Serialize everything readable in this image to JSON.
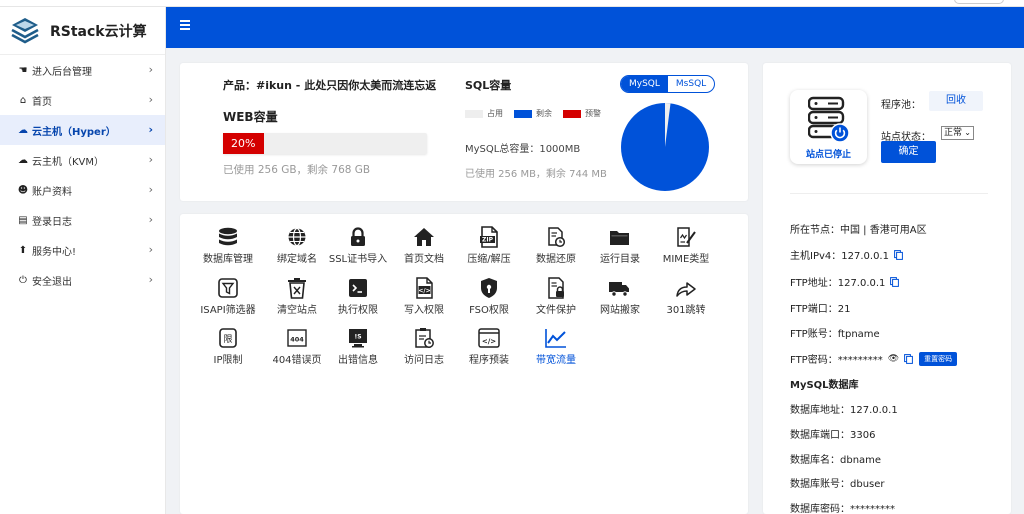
{
  "brand": {
    "name": "RStack云计算"
  },
  "sidebar": {
    "items": [
      {
        "label": "进入后台管理",
        "icon": "hand-pointer-icon",
        "glyph": "☚",
        "active": false
      },
      {
        "label": "首页",
        "icon": "home-icon",
        "glyph": "⌂",
        "active": false
      },
      {
        "label": "云主机（Hyper）",
        "icon": "cloud-server-icon",
        "glyph": "☁",
        "active": true
      },
      {
        "label": "云主机（KVM）",
        "icon": "cloud-server-icon",
        "glyph": "☁",
        "active": false
      },
      {
        "label": "账户资料",
        "icon": "user-card-icon",
        "glyph": "☻",
        "active": false
      },
      {
        "label": "登录日志",
        "icon": "document-icon",
        "glyph": "▤",
        "active": false
      },
      {
        "label": "服务中心!",
        "icon": "upload-icon",
        "glyph": "⬆",
        "active": false
      },
      {
        "label": "安全退出",
        "icon": "power-icon",
        "glyph": "⏻",
        "active": false
      }
    ]
  },
  "overview": {
    "product": "产品：#ikun - 此处只因你太美而流连忘返",
    "web_title": "WEB容量",
    "web_percent": 20,
    "web_percent_label": "20%",
    "web_used": "已使用 256 GB，剩余 768 GB",
    "sql_title": "SQL容量",
    "legend": [
      {
        "label": "占用",
        "color": "#eeeeee"
      },
      {
        "label": "剩余",
        "color": "#0052d9"
      },
      {
        "label": "预警",
        "color": "#d40000"
      }
    ],
    "sql_total": "MySQL总容量：1000MB",
    "sql_used": "已使用 256 MB，剩余 744 MB",
    "db_tabs": [
      {
        "label": "MySQL",
        "active": true
      },
      {
        "label": "MsSQL",
        "active": false
      }
    ],
    "pie": {
      "used_fraction": 0.02,
      "used_color": "#eeeeee",
      "remaining_color": "#0052d9"
    }
  },
  "tools": [
    {
      "label": "数据库管理",
      "icon": "database-icon"
    },
    {
      "label": "绑定域名",
      "icon": "globe-icon"
    },
    {
      "label": "SSL证书导入",
      "icon": "lock-icon"
    },
    {
      "label": "首页文档",
      "icon": "home-icon"
    },
    {
      "label": "压缩/解压",
      "icon": "zip-file-icon"
    },
    {
      "label": "数据还原",
      "icon": "file-restore-icon"
    },
    {
      "label": "运行目录",
      "icon": "folder-icon"
    },
    {
      "label": "MIME类型",
      "icon": "file-edit-icon"
    },
    {
      "label": "ISAPI筛选器",
      "icon": "filter-icon"
    },
    {
      "label": "清空站点",
      "icon": "trash-icon"
    },
    {
      "label": "执行权限",
      "icon": "terminal-icon"
    },
    {
      "label": "写入权限",
      "icon": "code-file-icon"
    },
    {
      "label": "FSO权限",
      "icon": "shield-icon"
    },
    {
      "label": "文件保护",
      "icon": "file-lock-icon"
    },
    {
      "label": "网站搬家",
      "icon": "truck-icon"
    },
    {
      "label": "301跳转",
      "icon": "share-arrow-icon"
    },
    {
      "label": "IP限制",
      "icon": "restrict-icon"
    },
    {
      "label": "404错误页",
      "icon": "page-404-icon"
    },
    {
      "label": "出错信息",
      "icon": "error-screen-icon"
    },
    {
      "label": "访问日志",
      "icon": "log-clock-icon"
    },
    {
      "label": "程序预装",
      "icon": "code-window-icon"
    },
    {
      "label": "带宽流量",
      "icon": "line-chart-icon"
    }
  ],
  "site": {
    "stop_label": "站点已停止",
    "pool_label": "程序池：",
    "pool_button": "回收",
    "status_label": "站点状态：",
    "status_value": "正常",
    "confirm_button": "确定",
    "node": "所在节点：中国 | 香港可用A区",
    "ipv4": "主机IPv4：127.0.0.1",
    "ftp_addr": "FTP地址：127.0.0.1",
    "ftp_port": "FTP端口：21",
    "ftp_user": "FTP账号：ftpname",
    "ftp_pwd": "FTP密码：*********",
    "reset_button": "重置密码",
    "mysql_title": "MySQL数据库",
    "db_addr": "数据库地址：127.0.0.1",
    "db_port": "数据库端口：3306",
    "db_name": "数据库名：dbname",
    "db_user": "数据库账号：dbuser",
    "db_pwd": "数据库密码：*********"
  },
  "colors": {
    "primary": "#0052d9",
    "danger": "#d40000",
    "bg": "#f0f2f5"
  }
}
